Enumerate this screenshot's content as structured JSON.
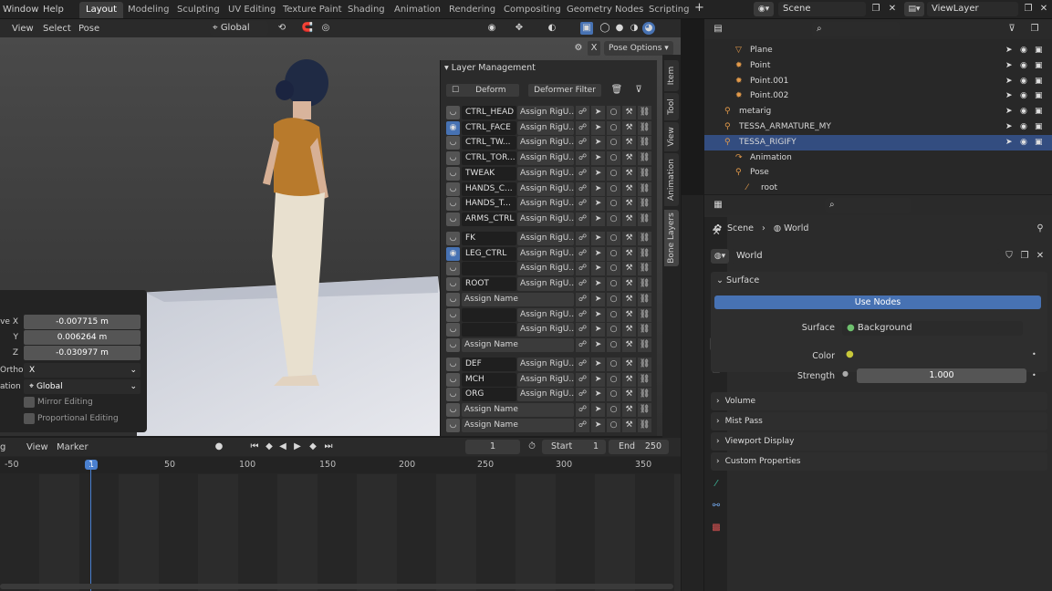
{
  "topbar": {
    "menus": [
      "Window",
      "Help"
    ],
    "workspaces": [
      "Layout",
      "Modeling",
      "Sculpting",
      "UV Editing",
      "Texture Paint",
      "Shading",
      "Animation",
      "Rendering",
      "Compositing",
      "Geometry Nodes",
      "Scripting"
    ],
    "add_tab": "+",
    "scene": "Scene",
    "view_layer": "ViewLayer"
  },
  "viewport": {
    "menus": [
      "View",
      "Select",
      "Pose"
    ],
    "orientation": "Global",
    "pose_options": "Pose Options",
    "close": "X"
  },
  "layer_management": {
    "title": "Layer Management",
    "deform_btn": "Deform",
    "filter_btn": "Deformer Filter",
    "groups": [
      [
        {
          "name": "CTRL_HEAD",
          "assign": "Assign RigU...",
          "eye": false
        },
        {
          "name": "CTRL_FACE",
          "assign": "Assign RigU...",
          "eye": true
        },
        {
          "name": "CTRL_TW...",
          "assign": "Assign RigU...",
          "eye": false
        },
        {
          "name": "CTRL_TOR...",
          "assign": "Assign RigU...",
          "eye": false
        },
        {
          "name": "TWEAK",
          "assign": "Assign RigU...",
          "eye": false
        },
        {
          "name": "HANDS_C...",
          "assign": "Assign RigU...",
          "eye": false
        },
        {
          "name": "HANDS_T...",
          "assign": "Assign RigU...",
          "eye": false
        },
        {
          "name": "ARMS_CTRL",
          "assign": "Assign RigU...",
          "eye": false
        }
      ],
      [
        {
          "name": "FK",
          "assign": "Assign RigU...",
          "eye": false
        },
        {
          "name": "LEG_CTRL",
          "assign": "Assign RigU...",
          "eye": true
        },
        {
          "name": "",
          "assign": "Assign RigU...",
          "eye": false
        },
        {
          "name": "ROOT",
          "assign": "Assign RigU...",
          "eye": false
        },
        {
          "name": "",
          "assign": "Assign Name",
          "eye": false,
          "noname": true
        },
        {
          "name": "",
          "assign": "Assign RigU...",
          "eye": false
        },
        {
          "name": "",
          "assign": "Assign RigU...",
          "eye": false
        },
        {
          "name": "",
          "assign": "Assign Name",
          "eye": false,
          "noname": true
        }
      ],
      [
        {
          "name": "DEF",
          "assign": "Assign RigU...",
          "eye": false
        },
        {
          "name": "MCH",
          "assign": "Assign RigU...",
          "eye": false
        },
        {
          "name": "ORG",
          "assign": "Assign RigU...",
          "eye": false
        },
        {
          "name": "",
          "assign": "Assign Name",
          "eye": false,
          "noname": true
        },
        {
          "name": "",
          "assign": "Assign Name",
          "eye": false,
          "noname": true
        }
      ]
    ]
  },
  "side_tabs": [
    "Item",
    "Tool",
    "View",
    "Animation",
    "Bone Layers"
  ],
  "redo_panel": {
    "move_x_label": "ve X",
    "move_x": "-0.007715 m",
    "y_label": "Y",
    "y": "0.006264 m",
    "z_label": "Z",
    "z": "-0.030977 m",
    "ortho_label": "Ortho",
    "ortho": "X",
    "orientation_label": "ation",
    "orientation": "Global",
    "mirror": "Mirror Editing",
    "proportional": "Proportional Editing"
  },
  "timeline": {
    "menus": [
      "g",
      "View",
      "Marker"
    ],
    "current": "1",
    "start_label": "Start",
    "start": "1",
    "end_label": "End",
    "end": "250",
    "ticks": [
      "-50",
      "1",
      "50",
      "100",
      "150",
      "200",
      "250",
      "300",
      "350"
    ]
  },
  "outliner": {
    "rows": [
      {
        "name": "Plane",
        "indent": 2
      },
      {
        "name": "Point",
        "indent": 2
      },
      {
        "name": "Point.001",
        "indent": 2
      },
      {
        "name": "Point.002",
        "indent": 2
      },
      {
        "name": "metarig",
        "indent": 1
      },
      {
        "name": "TESSA_ARMATURE_MY",
        "indent": 1
      },
      {
        "name": "TESSA_RIGIFY",
        "indent": 1,
        "sel": true
      },
      {
        "name": "Animation",
        "indent": 2
      },
      {
        "name": "Pose",
        "indent": 2
      },
      {
        "name": "root",
        "indent": 3
      }
    ]
  },
  "properties": {
    "breadcrumb_scene": "Scene",
    "breadcrumb_world": "World",
    "world_name": "World",
    "surface_title": "Surface",
    "use_nodes": "Use Nodes",
    "surface_label": "Surface",
    "surface_value": "Background",
    "color_label": "Color",
    "strength_label": "Strength",
    "strength": "1.000",
    "sections": [
      "Volume",
      "Mist Pass",
      "Viewport Display",
      "Custom Properties"
    ]
  }
}
